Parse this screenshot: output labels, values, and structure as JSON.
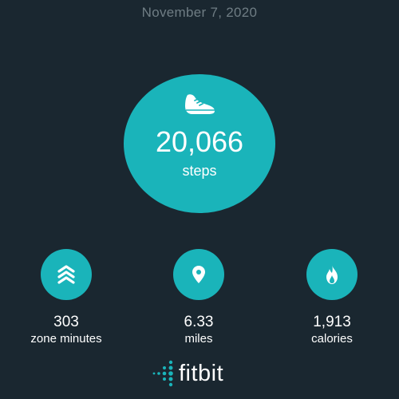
{
  "header": {
    "date": "November 7, 2020"
  },
  "steps": {
    "value": "20,066",
    "unit": "steps",
    "icon": "shoe-icon"
  },
  "stats": [
    {
      "value": "303",
      "label": "zone minutes",
      "icon": "chevrons-up-icon"
    },
    {
      "value": "6.33",
      "label": "miles",
      "icon": "location-pin-icon"
    },
    {
      "value": "1,913",
      "label": "calories",
      "icon": "flame-icon"
    }
  ],
  "brand": {
    "name": "fitbit"
  },
  "colors": {
    "background": "#1a2730",
    "accent": "#1ab4ba",
    "date_text": "#6f7d84",
    "text": "#ffffff"
  }
}
